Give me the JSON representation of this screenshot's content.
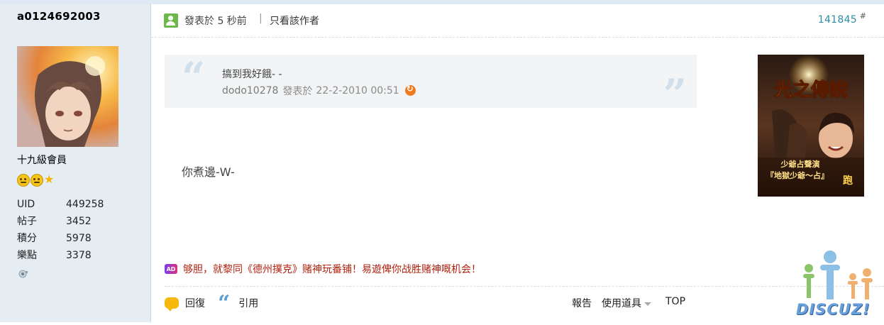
{
  "user": {
    "username": "a0124692003",
    "rank": "十九級會員",
    "stats": [
      {
        "key": "UID",
        "value": "449258"
      },
      {
        "key": "帖子",
        "value": "3452"
      },
      {
        "key": "積分",
        "value": "5978"
      },
      {
        "key": "樂點",
        "value": "3378"
      }
    ]
  },
  "post": {
    "posted_label": "發表於 5 秒前",
    "separator": "|",
    "only_author": "只看該作者",
    "post_number": "141845",
    "hash": "#",
    "quote": {
      "text": "搞到我好餓- -",
      "author": "dodo10278",
      "posted_label": "發表於",
      "date": "22-2-2010 00:51"
    },
    "message": "你煮邊-W-"
  },
  "ad": {
    "badge": "AD",
    "text": "够胆，就黎同《德州撲克》赌神玩番铺！易遊俾你战胜赌神嘅机会！"
  },
  "actions": {
    "reply": "回復",
    "quote": "引用",
    "report": "報告",
    "tools": "使用道具",
    "top": "TOP"
  },
  "banner": {
    "title": "光之傳說",
    "line1": "少爺占聲演",
    "line2": "『地獄少爺〜占』",
    "corner": "跑"
  },
  "logo": {
    "text": "DISCUZ!"
  },
  "colors": {
    "sidebar_bg": "#e5edf2",
    "post_number": "#2f8ca3",
    "ad_text": "#b0220f",
    "online_icon": "#6cb84a"
  }
}
